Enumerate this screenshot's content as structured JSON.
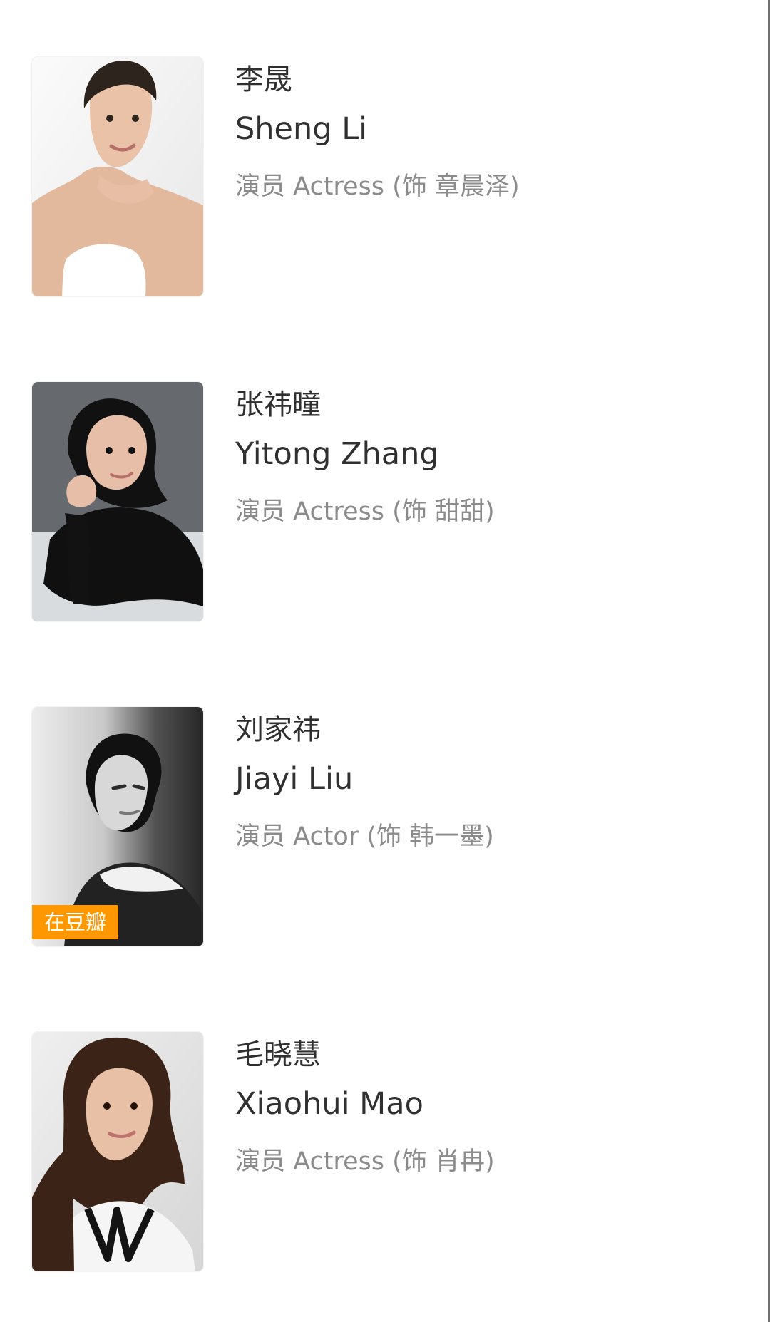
{
  "cast": [
    {
      "chinese_name": "李晟",
      "english_name": "Sheng Li",
      "role": "演员 Actress (饰 章晨泽)",
      "portrait_icon": "person-portrait-icon"
    },
    {
      "chinese_name": "张祎曈",
      "english_name": "Yitong Zhang",
      "role": "演员 Actress (饰 甜甜)",
      "portrait_icon": "person-portrait-icon"
    },
    {
      "chinese_name": "刘家祎",
      "english_name": "Jiayi Liu",
      "role": "演员 Actor (饰 韩一墨)",
      "badge": "在豆瓣",
      "portrait_icon": "person-portrait-icon"
    },
    {
      "chinese_name": "毛晓慧",
      "english_name": "Xiaohui Mao",
      "role": "演员 Actress (饰 肖冉)",
      "portrait_icon": "person-portrait-icon"
    }
  ],
  "colors": {
    "background": "#ffffff",
    "primary_text": "#2f2f2f",
    "secondary_text": "#8b8b8b",
    "badge_background": "#ff9800"
  }
}
